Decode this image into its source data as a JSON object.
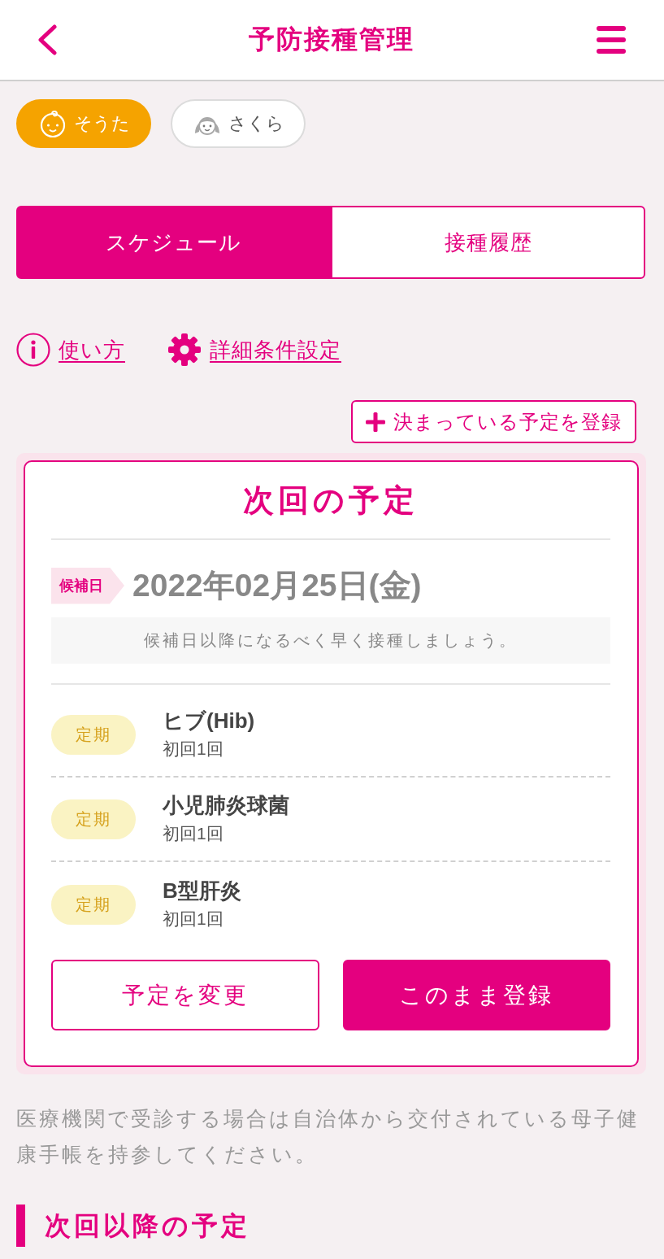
{
  "header": {
    "title": "予防接種管理"
  },
  "children": [
    {
      "kind": "baby",
      "name": "そうた",
      "selected": true
    },
    {
      "kind": "girl",
      "name": "さくら",
      "selected": false
    }
  ],
  "tabs": [
    {
      "label": "スケジュール",
      "selected": true
    },
    {
      "label": "接種履歴",
      "selected": false
    }
  ],
  "links": [
    {
      "kind": "info",
      "label": "使い方"
    },
    {
      "kind": "settings",
      "label": "詳細条件設定"
    }
  ],
  "register_button": {
    "label": "決まっている予定を登録"
  },
  "next_schedule": {
    "title": "次回の予定",
    "date_tag": "候補日",
    "date": "2022年02月25日(金)",
    "hint": "候補日以降になるべく早く接種しましょう。",
    "vaccines": [
      {
        "type_badge": "定期",
        "name": "ヒブ(Hib)",
        "dose": "初回1回"
      },
      {
        "type_badge": "定期",
        "name": "小児肺炎球菌",
        "dose": "初回1回"
      },
      {
        "type_badge": "定期",
        "name": "B型肝炎",
        "dose": "初回1回"
      }
    ],
    "buttons": [
      {
        "kind": "outline",
        "label": "予定を変更"
      },
      {
        "kind": "primary",
        "label": "このまま登録"
      }
    ]
  },
  "notice": "医療機関で受診する場合は自治体から交付されている母子健康手帳を持参してください。",
  "section_heading": "次回以降の予定"
}
